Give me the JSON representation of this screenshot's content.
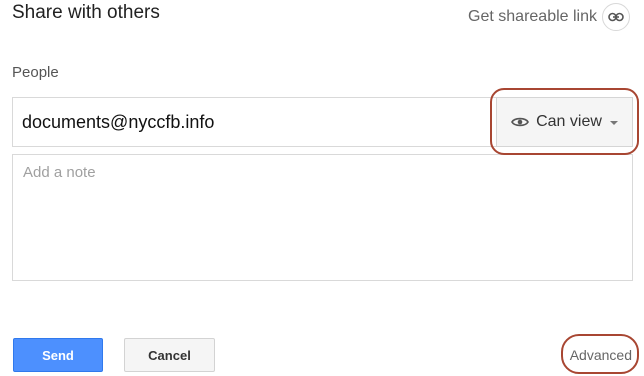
{
  "dialog": {
    "title": "Share with others"
  },
  "share_link": {
    "label": "Get shareable link",
    "icon": "link-icon"
  },
  "people": {
    "label": "People",
    "value": "documents@nyccfb.info"
  },
  "permission": {
    "label": "Can view",
    "icon": "eye-icon"
  },
  "note": {
    "placeholder": "Add a note"
  },
  "actions": {
    "send_label": "Send",
    "cancel_label": "Cancel",
    "advanced_label": "Advanced"
  },
  "colors": {
    "accent": "#4d90fe",
    "highlight_outline": "#a84632"
  }
}
